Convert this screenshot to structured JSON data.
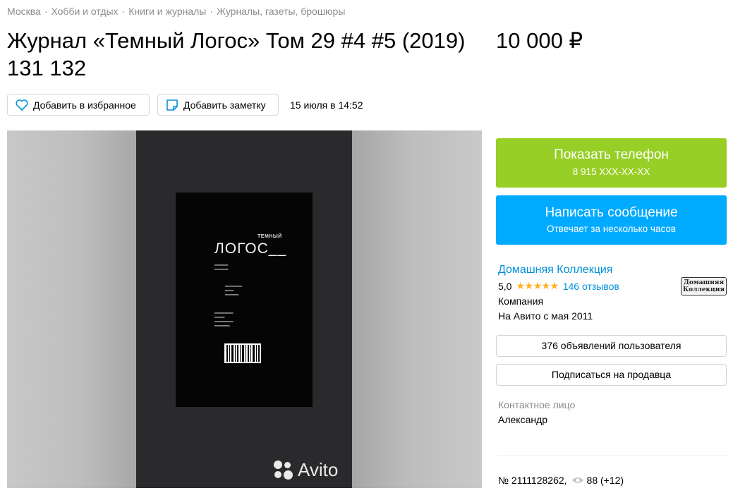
{
  "breadcrumbs": [
    "Москва",
    "Хобби и отдых",
    "Книги и журналы",
    "Журналы, газеты, брошюры"
  ],
  "breadcrumb_separator": "·",
  "title": "Журнал «Темный Логос» Том 29 #4 #5 (2019) 131 132",
  "price": "10 000 ₽",
  "actions": {
    "favorite_label": "Добавить в избранное",
    "note_label": "Добавить заметку",
    "date": "15 июля в 14:52"
  },
  "photo": {
    "label_small_title": "ТЕМНЫЙ",
    "label_big_title": "ЛОГОС__",
    "watermark": "Avito"
  },
  "contact_buttons": {
    "phone_label": "Показать телефон",
    "phone_number": "8 915 XXX-XX-XX",
    "message_label": "Написать сообщение",
    "message_sub": "Отвечает за несколько часов"
  },
  "seller": {
    "name": "Домашняя Коллекция",
    "rating": "5,0",
    "stars": "★★★★★",
    "reviews": "146 отзывов",
    "type": "Компания",
    "since": "На Авито с мая 2011",
    "logo_text": "Домашняя Коллекция",
    "ads_button": "376 объявлений пользователя",
    "subscribe_button": "Подписаться на продавца"
  },
  "contact": {
    "label": "Контактное лицо",
    "name": "Александр"
  },
  "meta": {
    "number": "№ 2111128262,",
    "views": "88 (+12)"
  },
  "colors": {
    "phone_button": "#97cf26",
    "message_button": "#00aaff",
    "link": "#0091d9",
    "stars": "#ffb021"
  }
}
